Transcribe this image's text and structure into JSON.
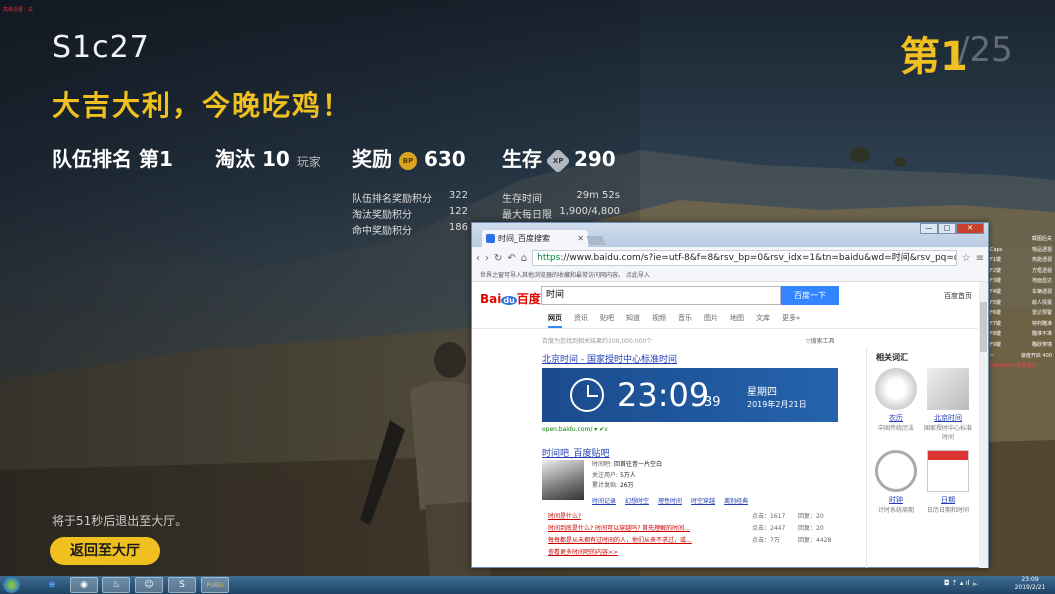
{
  "game": {
    "corner_text": "高级设置：关",
    "match_id": "S1c27",
    "headline": "大吉大利，今晚吃鸡！",
    "rank_prefix": "第1",
    "rank_total": "/25",
    "stats": {
      "team_rank_label": "队伍排名",
      "team_rank_value": "第1",
      "kills_label": "淘汰",
      "kills_value": "10",
      "kills_unit": "玩家",
      "reward_label": "奖励",
      "bp_icon": "BP",
      "bp_value": "630",
      "survival_label": "生存",
      "xp_icon": "XP",
      "xp_value": "290"
    },
    "bp_breakdown": [
      {
        "label": "队伍排名奖励积分",
        "value": "322"
      },
      {
        "label": "淘汰奖励积分",
        "value": "122"
      },
      {
        "label": "命中奖励积分",
        "value": "186"
      }
    ],
    "xp_breakdown": [
      {
        "label": "生存时间",
        "value": "29m 52s"
      },
      {
        "label": "最大每日限制",
        "value": "1,900/4,800"
      }
    ],
    "exit_note": "将于51秒后退出至大厅。",
    "lobby_button": "返回至大厅",
    "side_keys": [
      {
        "k": "",
        "v": "截图后关"
      },
      {
        "k": "Caps",
        "v": "物品透视"
      },
      {
        "k": "F1键",
        "v": "热能透视"
      },
      {
        "k": "F2键",
        "v": "方框透视"
      },
      {
        "k": "F3键",
        "v": "地面显达"
      },
      {
        "k": "F4键",
        "v": "车辆透视"
      },
      {
        "k": "F5键",
        "v": "敌人情报"
      },
      {
        "k": "F6键",
        "v": "雷达预警"
      },
      {
        "k": "F7键",
        "v": "特判瞄准"
      },
      {
        "k": "F8键",
        "v": "瞄准不准"
      },
      {
        "k": "F9键",
        "v": "瞄跃穿墙"
      },
      {
        "k": "~",
        "v": "速度开启 400"
      }
    ],
    "side_warning": "(Ctrl+End 安全退出)"
  },
  "browser": {
    "tab_title": "时间_百度搜索",
    "url_https": "https",
    "url_rest": "://www.baidu.com/s?ie=utf-8&f=8&rsv_bp=0&rsv_idx=1&tn=baidu&wd=时间&rsv_pq=d",
    "infobar": "世界之窗可导入其他浏览器的收藏和最常访问网内容。  点此导入",
    "window_buttons": {
      "min": "—",
      "max": "□",
      "close": "✕"
    },
    "baidu": {
      "logo_bai": "Bai",
      "logo_du": "du",
      "logo_cn": "百度",
      "query": "时间",
      "search_button": "百度一下",
      "home_link": "百度首页",
      "nav": [
        "网页",
        "资讯",
        "贴吧",
        "知道",
        "视频",
        "音乐",
        "图片",
        "地图",
        "文库",
        "更多»"
      ],
      "result_count": "百度为您找到相关结果约100,000,000个",
      "tools": "▽搜索工具",
      "r1_title": "北京时间 - 国家授时中心标准时间",
      "clock_time": "23:09",
      "clock_sec": "39",
      "clock_day": "星期四",
      "clock_date": "2019年2月21日",
      "r1_url": "open.baidu.com/  ▾  ✔v",
      "r2_title": "时间吧_百度贴吧",
      "r2_meta": [
        {
          "k": "时间吧:",
          "v": "回首往昔一片空白"
        },
        {
          "k": "关注用户:",
          "v": "5万人"
        },
        {
          "k": "累计发贴:",
          "v": "26万"
        }
      ],
      "r2_links": [
        "时间记录",
        "幻想时空",
        "理性时间",
        "时空穿越",
        "离别经典"
      ],
      "r2_rows": [
        {
          "t": "时间是什么?",
          "c": "点击：1617",
          "r": "回复：20"
        },
        {
          "t": "时间到底是什么? 时间可以穿越吗? 首先理解的时间...",
          "c": "点击：2447",
          "r": "回复：20"
        },
        {
          "t": "每每都是从未拥有过时间的人，他们从来不求过，或...",
          "c": "点击：7万",
          "r": "回复：4428"
        },
        {
          "t": "查看更多时间吧的内容>>",
          "c": "",
          "r": ""
        }
      ],
      "related_title": "相关词汇",
      "related": [
        {
          "name": "农历",
          "desc": "中国传统历法"
        },
        {
          "name": "北京时间",
          "desc": "国家授时中心标准时间"
        },
        {
          "name": "时钟",
          "desc": "计时系统周期"
        },
        {
          "name": "日期",
          "desc": "日历日期和时间"
        }
      ]
    }
  },
  "taskbar": {
    "apps": [
      "e",
      "◉",
      "♨",
      "☺",
      "S",
      "PUBG"
    ],
    "time": "23:09",
    "date": "2019/2/21",
    "tray": "◘ ⇡ ▴ ıl 🔈"
  }
}
